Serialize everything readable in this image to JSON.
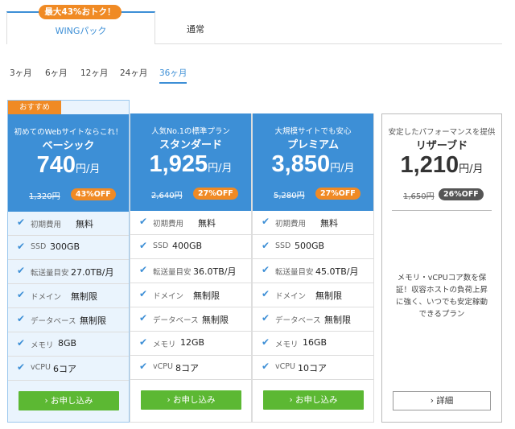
{
  "top_tabs": {
    "badge": "最大43%おトク！",
    "wing_label": "WINGパック",
    "normal_label": "通常"
  },
  "durations": [
    "3ヶ月",
    "6ヶ月",
    "12ヶ月",
    "24ヶ月",
    "36ヶ月"
  ],
  "active_duration": "36ヶ月",
  "recommend_badge": "おすすめ",
  "price_unit": "円/月",
  "check_icon": "check-icon",
  "plans": [
    {
      "tagline": "初めてのWebサイトならこれ！",
      "name": "ベーシック",
      "price": "740",
      "old_price": "1,320円",
      "discount": "43%OFF",
      "features": [
        {
          "label": "初期費用",
          "value": "無料"
        },
        {
          "label": "SSD",
          "value": "300GB"
        },
        {
          "label": "転送量目安",
          "value": "27.0TB/月"
        },
        {
          "label": "ドメイン",
          "value": "無制限"
        },
        {
          "label": "データベース",
          "value": "無制限"
        },
        {
          "label": "メモリ",
          "value": "8GB"
        },
        {
          "label": "vCPU",
          "value": "6コア"
        }
      ],
      "button": "› お申し込み"
    },
    {
      "tagline": "人気No.1の標準プラン",
      "name": "スタンダード",
      "price": "1,925",
      "old_price": "2,640円",
      "discount": "27%OFF",
      "features": [
        {
          "label": "初期費用",
          "value": "無料"
        },
        {
          "label": "SSD",
          "value": "400GB"
        },
        {
          "label": "転送量目安",
          "value": "36.0TB/月"
        },
        {
          "label": "ドメイン",
          "value": "無制限"
        },
        {
          "label": "データベース",
          "value": "無制限"
        },
        {
          "label": "メモリ",
          "value": "12GB"
        },
        {
          "label": "vCPU",
          "value": "8コア"
        }
      ],
      "button": "› お申し込み"
    },
    {
      "tagline": "大規模サイトでも安心",
      "name": "プレミアム",
      "price": "3,850",
      "old_price": "5,280円",
      "discount": "27%OFF",
      "features": [
        {
          "label": "初期費用",
          "value": "無料"
        },
        {
          "label": "SSD",
          "value": "500GB"
        },
        {
          "label": "転送量目安",
          "value": "45.0TB/月"
        },
        {
          "label": "ドメイン",
          "value": "無制限"
        },
        {
          "label": "データベース",
          "value": "無制限"
        },
        {
          "label": "メモリ",
          "value": "16GB"
        },
        {
          "label": "vCPU",
          "value": "10コア"
        }
      ],
      "button": "› お申し込み"
    }
  ],
  "reserve": {
    "tagline": "安定したパフォーマンスを提供",
    "name": "リザーブド",
    "price": "1,210",
    "old_price": "1,650円",
    "discount": "26%OFF",
    "description": "メモリ・vCPUコア数を保証！収容ホストの負荷上昇に強く、いつでも安定稼動できるプラン",
    "button": "› 詳細"
  }
}
